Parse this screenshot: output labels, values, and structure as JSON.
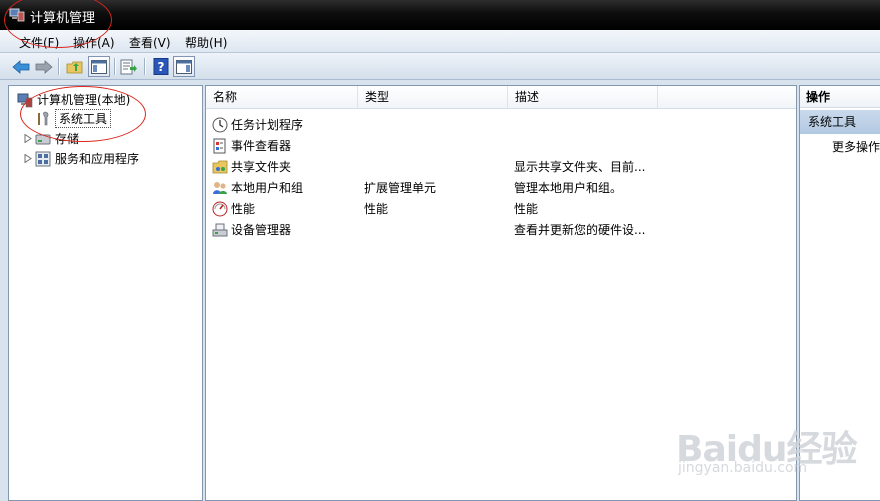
{
  "window": {
    "title": "计算机管理"
  },
  "menu": [
    "文件(F)",
    "操作(A)",
    "查看(V)",
    "帮助(H)"
  ],
  "tree": {
    "root": "计算机管理(本地)",
    "items": [
      "系统工具",
      "存储",
      "服务和应用程序"
    ]
  },
  "list": {
    "columns": [
      "名称",
      "类型",
      "描述"
    ],
    "rows": [
      {
        "name": "任务计划程序",
        "type": "",
        "desc": ""
      },
      {
        "name": "事件查看器",
        "type": "",
        "desc": ""
      },
      {
        "name": "共享文件夹",
        "type": "",
        "desc": "显示共享文件夹、目前..."
      },
      {
        "name": "本地用户和组",
        "type": "扩展管理单元",
        "desc": "管理本地用户和组。"
      },
      {
        "name": "性能",
        "type": "性能",
        "desc": "性能"
      },
      {
        "name": "设备管理器",
        "type": "",
        "desc": "查看并更新您的硬件设..."
      }
    ]
  },
  "actions": {
    "title": "操作",
    "section": "系统工具",
    "more": "更多操作"
  },
  "watermark": {
    "main": "Baidu经验",
    "sub": "jingyan.baidu.com"
  },
  "colors": {
    "annotation": "#d8261c",
    "selection": "#b3c9e2"
  }
}
